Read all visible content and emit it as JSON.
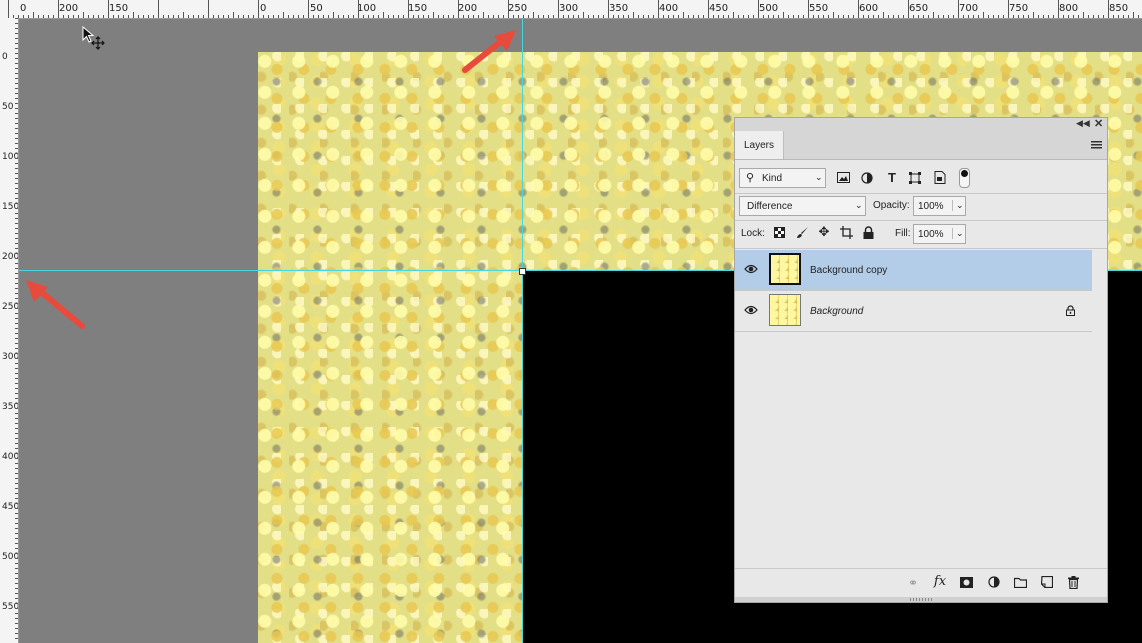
{
  "rulers": {
    "top_labels": [
      "0",
      "200",
      "150",
      "0",
      "50",
      "100",
      "150",
      "200",
      "250",
      "300",
      "350",
      "400",
      "450",
      "500",
      "550",
      "600",
      "650",
      "700",
      "750",
      "800",
      "850"
    ],
    "left_labels": [
      "0",
      "50",
      "100",
      "150",
      "200",
      "250",
      "300",
      "350",
      "400",
      "450",
      "500",
      "550"
    ]
  },
  "layers_panel": {
    "tab_label": "Layers",
    "filter_kind": "Kind",
    "blend_mode": "Difference",
    "opacity_label": "Opacity:",
    "opacity_value": "100%",
    "lock_label": "Lock:",
    "fill_label": "Fill:",
    "fill_value": "100%",
    "layers": [
      {
        "name": "Background copy",
        "selected": true,
        "visible": true,
        "locked": false
      },
      {
        "name": "Background",
        "selected": false,
        "visible": true,
        "locked": true
      }
    ]
  },
  "colors": {
    "guide": "#46d6e0",
    "selection": "#b3cde8",
    "arrow": "#e84a3c"
  }
}
